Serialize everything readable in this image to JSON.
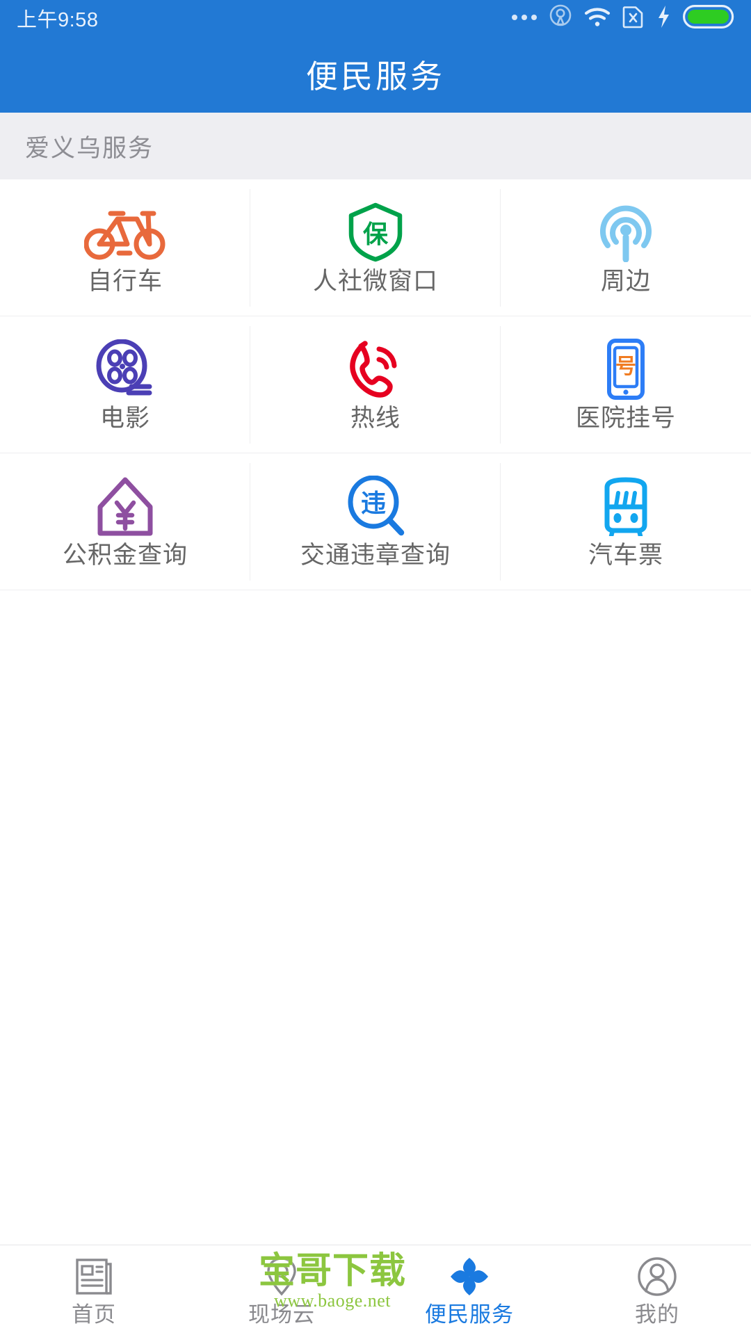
{
  "status_bar": {
    "time": "上午9:58",
    "icons": [
      "more-dots-icon",
      "location-broadcast-icon",
      "wifi-icon",
      "sim-card-no-signal-icon",
      "charging-bolt-icon",
      "battery-full-icon"
    ],
    "battery_color": "#2ecc22",
    "icon_color": "#d8e7f8"
  },
  "app_bar": {
    "title": "便民服务",
    "background": "#2279d4",
    "title_color": "#ffffff"
  },
  "section": {
    "title": "爱义乌服务",
    "background": "#eeeef2",
    "text_color": "#8d8d93"
  },
  "grid": {
    "columns": 3,
    "items": [
      {
        "label": "自行车",
        "icon": "bicycle-icon",
        "color": "#e8693c"
      },
      {
        "label": "人社微窗口",
        "icon": "shield-bao-icon",
        "color": "#00a24a"
      },
      {
        "label": "周边",
        "icon": "broadcast-signal-icon",
        "color": "#7ec8f0"
      },
      {
        "label": "电影",
        "icon": "film-reel-icon",
        "color": "#4b3fb5"
      },
      {
        "label": "热线",
        "icon": "phone-ringing-icon",
        "color": "#e60020"
      },
      {
        "label": "医院挂号",
        "icon": "phone-number-ticket-icon",
        "color": "#2d7df6"
      },
      {
        "label": "公积金查询",
        "icon": "house-yuan-icon",
        "color": "#8e4fa0"
      },
      {
        "label": "交通违章查询",
        "icon": "magnifier-wei-icon",
        "color": "#1a7ae0"
      },
      {
        "label": "汽车票",
        "icon": "bus-icon",
        "color": "#12a6ef"
      }
    ]
  },
  "tab_bar": {
    "active_color": "#1a7ae0",
    "inactive_color": "#8a8a8e",
    "tabs": [
      {
        "label": "首页",
        "icon": "newspaper-icon",
        "active": false
      },
      {
        "label": "现场云",
        "icon": "location-pin-icon",
        "active": false
      },
      {
        "label": "便民服务",
        "icon": "service-logo-icon",
        "active": true
      },
      {
        "label": "我的",
        "icon": "person-icon",
        "active": false
      }
    ]
  },
  "watermark": {
    "main": "宝哥下载",
    "sub": "www.baoge.net",
    "color": "#8cc63f"
  }
}
